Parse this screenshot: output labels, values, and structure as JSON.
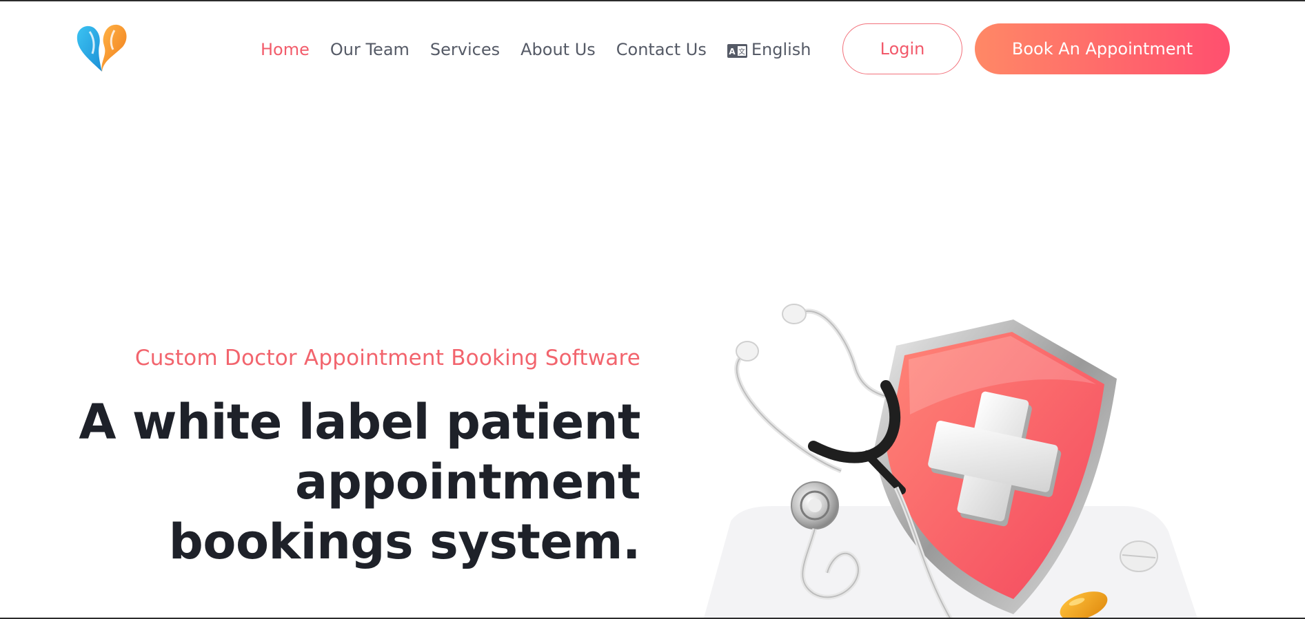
{
  "header": {
    "logo_icon": "heart-logo-icon",
    "nav": [
      {
        "label": "Home",
        "active": true
      },
      {
        "label": "Our Team",
        "active": false
      },
      {
        "label": "Services",
        "active": false
      },
      {
        "label": "About Us",
        "active": false
      },
      {
        "label": "Contact Us",
        "active": false
      }
    ],
    "language": {
      "icon": "language-icon",
      "label": "English"
    },
    "login_label": "Login",
    "book_label": "Book An Appointment"
  },
  "hero": {
    "subtitle": "Custom Doctor Appointment Booking Software",
    "title_lines": [
      "A white label patient",
      "appointment",
      "bookings system."
    ],
    "illustration": "medical-shield-stethoscope-illustration"
  },
  "colors": {
    "accent": "#f25c6b",
    "button_gradient_start": "#ff8866",
    "button_gradient_end": "#ff4f6f",
    "heading": "#1e2129",
    "nav_text": "#555a66"
  }
}
